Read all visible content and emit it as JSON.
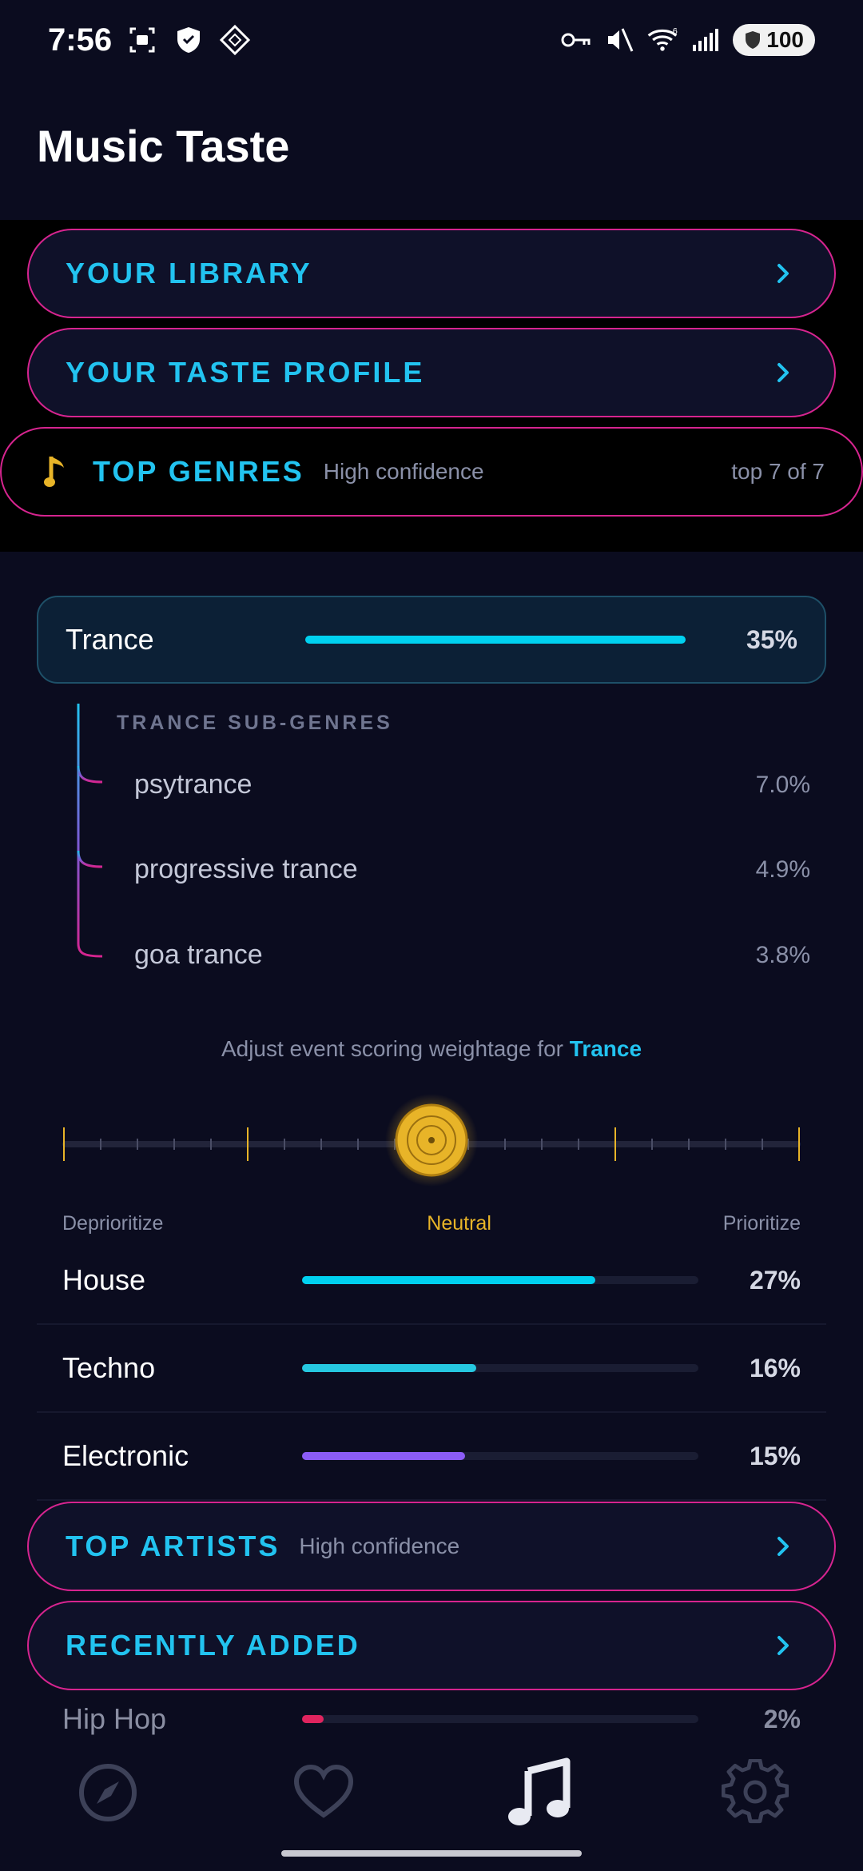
{
  "status_bar": {
    "time": "7:56",
    "battery": "100",
    "network_badge": "6"
  },
  "page": {
    "title": "Music Taste"
  },
  "sections": {
    "library": {
      "label": "YOUR LIBRARY"
    },
    "taste_profile": {
      "label": "YOUR TASTE PROFILE"
    },
    "top_genres": {
      "label": "TOP GENRES",
      "confidence": "High confidence",
      "count": "top 7 of 7"
    },
    "top_artists": {
      "label": "TOP ARTISTS",
      "confidence": "High confidence"
    },
    "recently_added": {
      "label": "RECENTLY ADDED"
    }
  },
  "selected_genre": {
    "name": "Trance",
    "pct": "35%",
    "share": 0.35,
    "color": "#00d1f0",
    "subgenres_title": "TRANCE SUB-GENRES",
    "subgenres": [
      {
        "name": "psytrance",
        "pct": "7.0%"
      },
      {
        "name": "progressive trance",
        "pct": "4.9%"
      },
      {
        "name": "goa trance",
        "pct": "3.8%"
      }
    ]
  },
  "weightage": {
    "prefix": "Adjust event scoring weightage for ",
    "genre": "Trance",
    "labels": {
      "left": "Deprioritize",
      "center": "Neutral",
      "right": "Prioritize"
    },
    "value": 0,
    "accent": "#e8b428"
  },
  "genres": [
    {
      "name": "House",
      "pct": "27%",
      "share": 0.27,
      "color": "#00d1f0"
    },
    {
      "name": "Techno",
      "pct": "16%",
      "share": 0.16,
      "color": "#26c8e0"
    },
    {
      "name": "Electronic",
      "pct": "15%",
      "share": 0.15,
      "color": "#8b5cf6"
    },
    {
      "name": "Hip Hop",
      "pct": "2%",
      "share": 0.02,
      "color": "#e0245e"
    }
  ],
  "nav": {
    "items": [
      "compass-icon",
      "heart-icon",
      "music-note-icon",
      "settings-icon"
    ],
    "active": "music-note-icon"
  },
  "colors": {
    "accent_cyan": "#22c3f0",
    "pill_border": "#d6248f",
    "background": "#0b0c1f"
  }
}
